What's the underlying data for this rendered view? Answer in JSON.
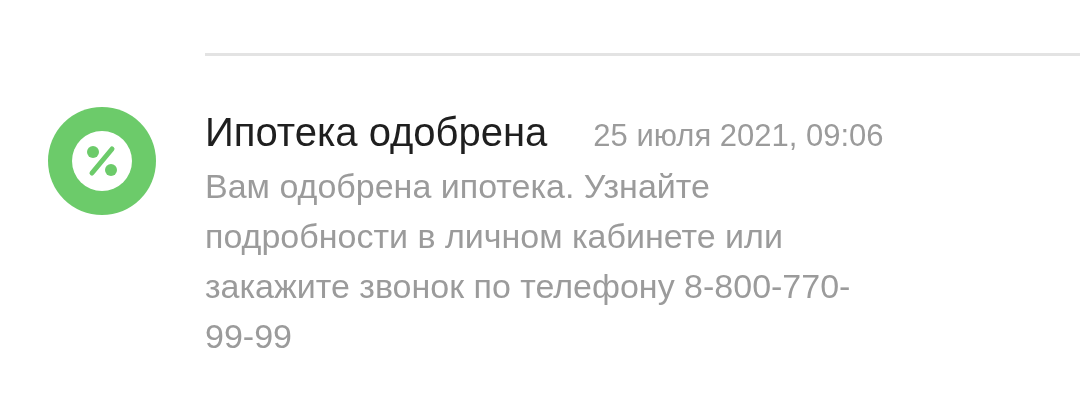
{
  "notification": {
    "title": "Ипотека одобрена",
    "time": "25 июля 2021, 09:06",
    "message": "Вам одобрена ипотека. Узнайте подробности в личном кабинете или закажите звонок по телефону 8-800-770-99-99"
  }
}
